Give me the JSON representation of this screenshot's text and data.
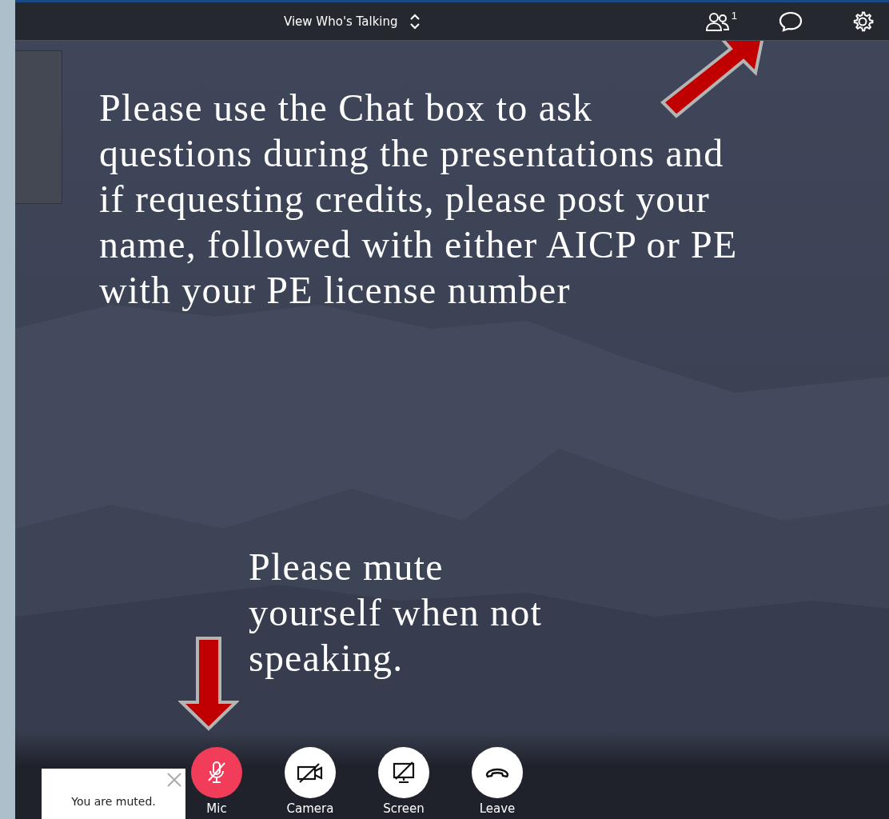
{
  "top_bar": {
    "view_label": "View Who's Talking",
    "participant_count": "1"
  },
  "annotations": [
    {
      "kind": "chat",
      "text": "Please use the Chat box to ask questions during the presentations and if requesting credits, please post your name, followed with either AICP or PE with your PE license number"
    },
    {
      "kind": "mute",
      "text": "Please mute yourself when not speaking."
    }
  ],
  "toast": {
    "text": "You are muted."
  },
  "controls": [
    {
      "kind": "mic",
      "label": "Mic",
      "muted": true
    },
    {
      "kind": "camera",
      "label": "Camera"
    },
    {
      "kind": "screen",
      "label": "Screen"
    },
    {
      "kind": "leave",
      "label": "Leave"
    }
  ]
}
